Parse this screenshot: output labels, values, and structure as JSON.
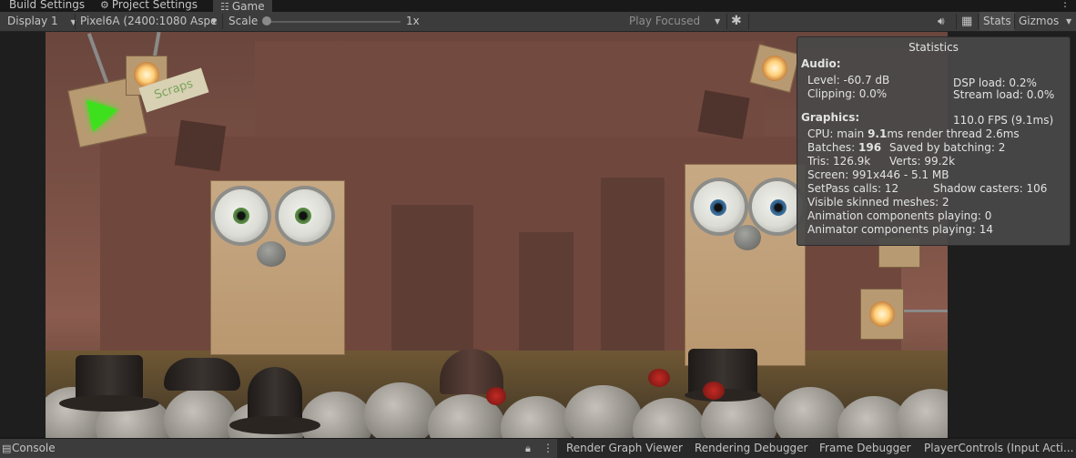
{
  "tabs": [
    {
      "label": "Build Settings",
      "active": false
    },
    {
      "label": "Project Settings",
      "active": false
    },
    {
      "label": "Game",
      "active": true
    }
  ],
  "toolbar": {
    "display": "Display 1",
    "device": "Pixel6A (2400:1080 Aspe",
    "scale_label": "Scale",
    "scale_value": "1x",
    "play_mode": "Play Focused",
    "stats_label": "Stats",
    "gizmos_label": "Gizmos"
  },
  "game": {
    "sign_text": "Scraps"
  },
  "stats": {
    "title": "Statistics",
    "audio_header": "Audio:",
    "level": "Level: -60.7 dB",
    "clipping": "Clipping: 0.0%",
    "dsp_load": "DSP load: 0.2%",
    "stream_load": "Stream load: 0.0%",
    "graphics_header": "Graphics:",
    "fps": "110.0 FPS (9.1ms)",
    "cpu_prefix": "CPU: main ",
    "cpu_main": "9.1",
    "cpu_suffix": "ms  render thread 2.6ms",
    "batches_prefix": "Batches: ",
    "batches": "196",
    "saved_by_batching": "Saved by batching: 2",
    "tris": "Tris: 126.9k",
    "verts": "Verts: 99.2k",
    "screen": "Screen: 991x446 - 5.1 MB",
    "setpass": "SetPass calls: 12",
    "shadow_casters": "Shadow casters: 106",
    "visible_skinned": "Visible skinned meshes: 2",
    "animation_components": "Animation components playing: 0",
    "animator_components": "Animator components playing: 14"
  },
  "bottom_tabs": {
    "console": "Console",
    "items": [
      "Render Graph Viewer",
      "Rendering Debugger",
      "Frame Debugger",
      "PlayerControls (Input Acti..."
    ]
  }
}
